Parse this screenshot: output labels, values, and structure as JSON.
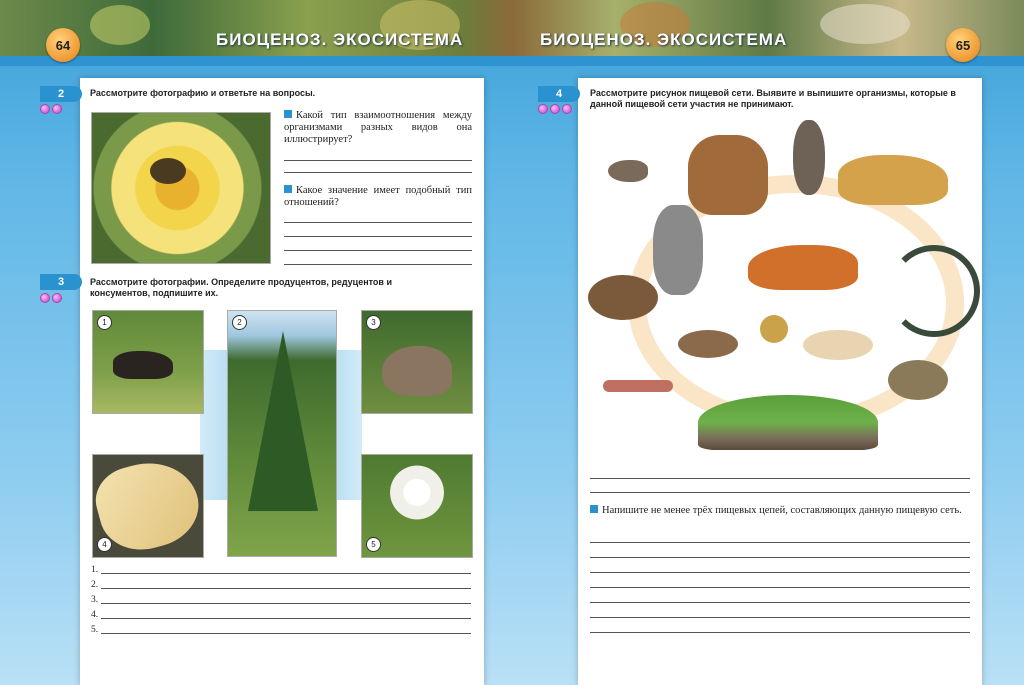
{
  "header": {
    "left_page_number": "64",
    "right_page_number": "65",
    "left_title": "БИОЦЕНОЗ. ЭКОСИСТЕМА",
    "right_title": "БИОЦЕНОЗ. ЭКОСИСТЕМА"
  },
  "left_page": {
    "task2": {
      "number": "2",
      "instruction": "Рассмотрите фотографию и ответьте на вопросы.",
      "question1": "Какой тип взаимоотношения между организмами разных видов она иллюстрирует?",
      "question2": "Какое значение имеет подобный тип отношений?"
    },
    "task3": {
      "number": "3",
      "instruction": "Рассмотрите фотографии. Определите продуцентов, редуцентов и консументов, подпишите их.",
      "photo_numbers": [
        "1",
        "2",
        "3",
        "4",
        "5"
      ],
      "answer_labels": [
        "1.",
        "2.",
        "3.",
        "4.",
        "5."
      ]
    }
  },
  "right_page": {
    "task4": {
      "number": "4",
      "instruction": "Рассмотрите рисунок пищевой сети. Выявите и выпишите организмы, которые в данной пищевой сети участия не принимают.",
      "question": "Напишите не менее трёх пищевых цепей, составляющих данную пищевую сеть."
    }
  },
  "colors": {
    "accent": "#2a93cf",
    "page_number_badge": "#f2a13c",
    "background": "#8fcdf0"
  },
  "icons": [
    "square-bullet-icon",
    "difficulty-dots-icon"
  ]
}
